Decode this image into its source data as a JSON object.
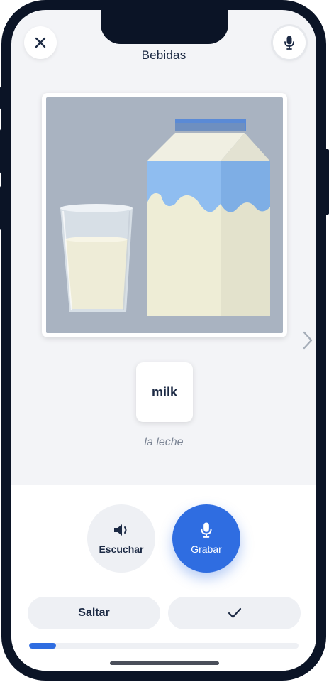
{
  "header": {
    "title": "Bebidas",
    "close_icon": "close-icon",
    "mic_icon": "microphone-icon"
  },
  "card": {
    "image": "milk-glass-and-carton-illustration",
    "word": "milk",
    "translation": "la leche",
    "next_icon": "chevron-right-icon"
  },
  "actions": {
    "listen_label": "Escuchar",
    "listen_icon": "speaker-icon",
    "record_label": "Grabar",
    "record_icon": "microphone-icon",
    "skip_label": "Saltar",
    "check_icon": "checkmark-icon"
  },
  "progress": {
    "fraction": 0.1
  },
  "colors": {
    "accent": "#2f6de1",
    "text": "#1c2a44",
    "muted": "#7b8494",
    "background": "#f3f4f7",
    "frame": "#0b1426"
  }
}
